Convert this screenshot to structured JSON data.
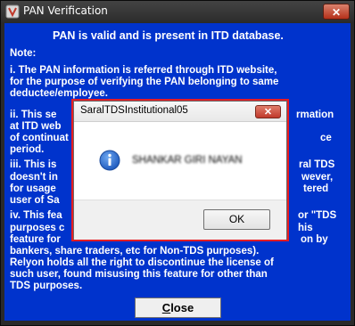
{
  "window": {
    "title": "PAN Verification",
    "close_glyph": "✕"
  },
  "content": {
    "heading": "PAN is valid and is present in ITD database.",
    "note_label": "Note:",
    "lines": [
      "i.  The PAN information is referred through ITD website,",
      "for the purpose of verifying the PAN belonging to same",
      "deductee/employee.",
      "ii.  This se",
      "at ITD web",
      "of continuat",
      "period.",
      "iii. This is",
      "doesn't in",
      "for usage",
      "user of Sa",
      "iv. This fea",
      "purposes c",
      "feature for",
      "bankers, share traders, etc for Non-TDS purposes).",
      "Relyon holds all the right to discontinue the license of",
      "such user, found misusing this feature for other than",
      "TDS purposes."
    ],
    "right_fragments": [
      "rmation",
      "ce",
      "ral TDS",
      "wever,",
      "tered",
      "or \"TDS",
      "his",
      "on by"
    ],
    "close_button": {
      "prefix": "",
      "mnemonic": "C",
      "rest": "lose"
    }
  },
  "dialog": {
    "title": "SaralTDSInstitutional05",
    "close_glyph": "✕",
    "message": "SHANKAR GIRI NAYAN",
    "ok_label": "OK",
    "icon": "info-icon"
  },
  "colors": {
    "content_bg": "#0033cc",
    "highlight_border": "#e51c23",
    "title_bar": "#2c2c2c"
  }
}
